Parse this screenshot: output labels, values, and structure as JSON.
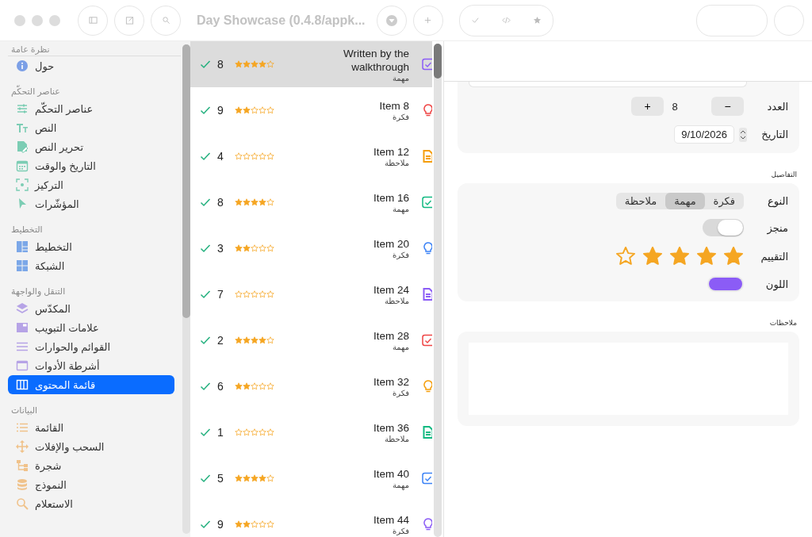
{
  "window": {
    "title": "Day Showcase (0.4.8/appk..."
  },
  "sidebar": {
    "sections": [
      {
        "title": "نظرة عامة",
        "items": [
          {
            "label": "حول",
            "selected": false
          }
        ]
      },
      {
        "title": "عناصر التحكّم",
        "items": [
          {
            "label": "عناصر التحكّم",
            "selected": false
          },
          {
            "label": "النص",
            "selected": false
          },
          {
            "label": "تحرير النص",
            "selected": false
          },
          {
            "label": "التاريخ والوقت",
            "selected": false
          },
          {
            "label": "التركيز",
            "selected": false
          },
          {
            "label": "المؤشّرات",
            "selected": false
          }
        ]
      },
      {
        "title": "التخطيط",
        "items": [
          {
            "label": "التخطيط",
            "selected": false
          },
          {
            "label": "الشبكة",
            "selected": false
          }
        ]
      },
      {
        "title": "التنقل والواجهة",
        "items": [
          {
            "label": "المكدّس",
            "selected": false
          },
          {
            "label": "علامات التبويب",
            "selected": false
          },
          {
            "label": "القوائم والحوارات",
            "selected": false
          },
          {
            "label": "أشرطة الأدوات",
            "selected": false
          },
          {
            "label": "قائمة المحتوى",
            "selected": true
          }
        ]
      },
      {
        "title": "البيانات",
        "items": [
          {
            "label": "القائمة",
            "selected": false
          },
          {
            "label": "السحب والإفلات",
            "selected": false
          },
          {
            "label": "شجرة",
            "selected": false
          },
          {
            "label": "النموذج",
            "selected": false
          },
          {
            "label": "الاستعلام",
            "selected": false
          }
        ]
      }
    ]
  },
  "list": [
    {
      "title": "Written by the walkthrough",
      "type": "مهمة",
      "kind": "task",
      "color": "#8b5cf6",
      "count": "8",
      "stars": 4,
      "done": true,
      "selected": true
    },
    {
      "title": "Item 8",
      "type": "فكرة",
      "kind": "idea",
      "color": "#ef4444",
      "count": "9",
      "stars": 2,
      "done": true,
      "selected": false
    },
    {
      "title": "Item 12",
      "type": "ملاحظة",
      "kind": "note",
      "color": "#f59e0b",
      "count": "4",
      "stars": 0,
      "done": true,
      "selected": false
    },
    {
      "title": "Item 16",
      "type": "مهمة",
      "kind": "task",
      "color": "#10b981",
      "count": "8",
      "stars": 4,
      "done": true,
      "selected": false
    },
    {
      "title": "Item 20",
      "type": "فكرة",
      "kind": "idea",
      "color": "#3b82f6",
      "count": "3",
      "stars": 2,
      "done": true,
      "selected": false
    },
    {
      "title": "Item 24",
      "type": "ملاحظة",
      "kind": "note",
      "color": "#8b5cf6",
      "count": "7",
      "stars": 0,
      "done": true,
      "selected": false
    },
    {
      "title": "Item 28",
      "type": "مهمة",
      "kind": "task",
      "color": "#ef4444",
      "count": "2",
      "stars": 4,
      "done": true,
      "selected": false
    },
    {
      "title": "Item 32",
      "type": "فكرة",
      "kind": "idea",
      "color": "#f59e0b",
      "count": "6",
      "stars": 2,
      "done": true,
      "selected": false
    },
    {
      "title": "Item 36",
      "type": "ملاحظة",
      "kind": "note",
      "color": "#10b981",
      "count": "1",
      "stars": 0,
      "done": true,
      "selected": false
    },
    {
      "title": "Item 40",
      "type": "مهمة",
      "kind": "task",
      "color": "#3b82f6",
      "count": "5",
      "stars": 4,
      "done": true,
      "selected": false
    },
    {
      "title": "Item 44",
      "type": "فكرة",
      "kind": "idea",
      "color": "#8b5cf6",
      "count": "9",
      "stars": 2,
      "done": true,
      "selected": false
    }
  ],
  "detail": {
    "count_label": "العدد",
    "increment": "+",
    "count": "8",
    "decrement": "−",
    "date_label": "التاريخ",
    "date": "9/10/2026",
    "details_title": "التفاصيل",
    "type_label": "النوع",
    "type_options": [
      {
        "label": "فكرة",
        "selected": false
      },
      {
        "label": "مهمة",
        "selected": true
      },
      {
        "label": "ملاحظة",
        "selected": false
      }
    ],
    "done_label": "منجز",
    "done": false,
    "rating_label": "التقييم",
    "rating": {
      "stars": 4
    },
    "color_label": "اللون",
    "color": "#8b5cf6",
    "notes_title": "ملاحظات"
  }
}
